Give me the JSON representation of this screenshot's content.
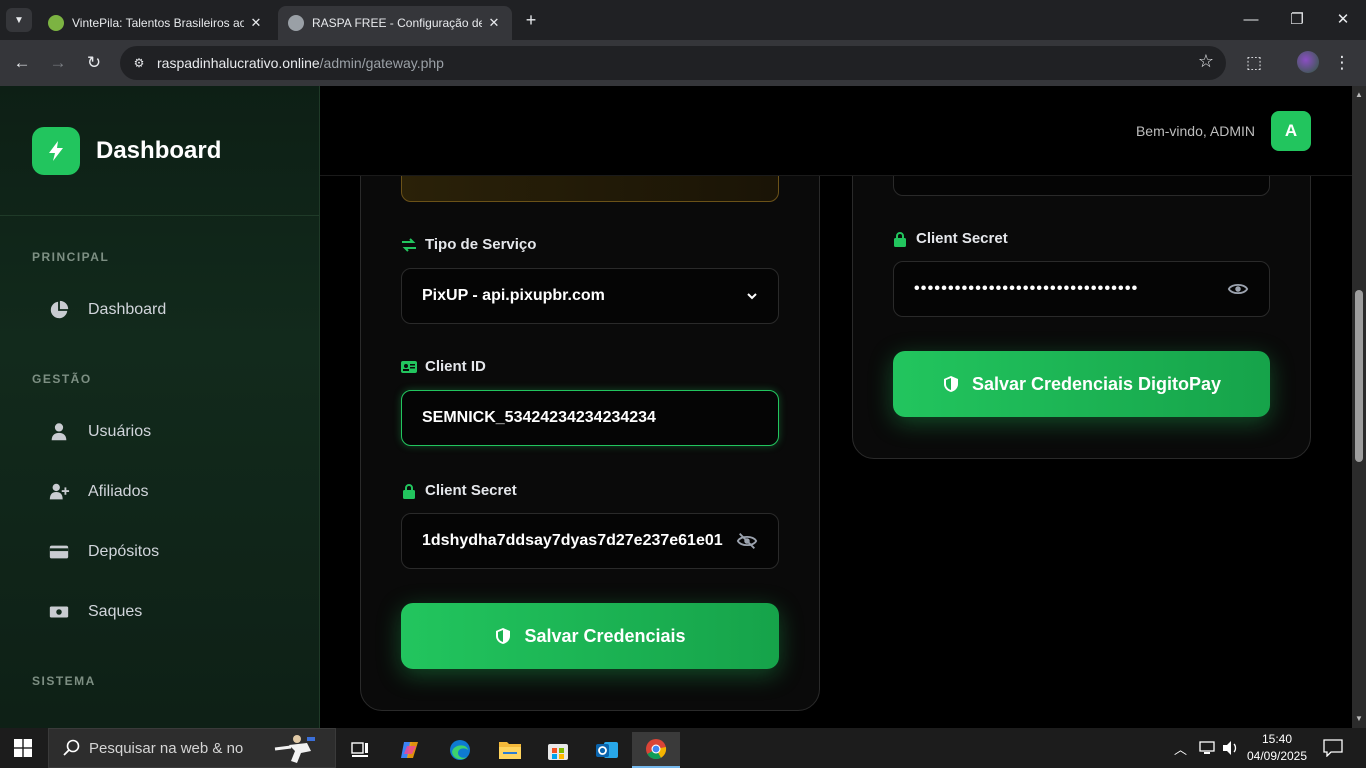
{
  "browser": {
    "tabs": [
      {
        "title": "VintePila: Talentos Brasileiros ao",
        "favicon_color": "#7cb342"
      },
      {
        "title": "RASPA FREE - Configuração de G",
        "favicon_color": "#9aa0a6"
      }
    ],
    "url_domain": "raspadinhalucrativo.online",
    "url_path": "/admin/gateway.php"
  },
  "sidebar": {
    "brand": "Dashboard",
    "sections": [
      {
        "title": "PRINCIPAL",
        "items": [
          {
            "label": "Dashboard",
            "icon": "chart-pie-icon"
          }
        ]
      },
      {
        "title": "GESTÃO",
        "items": [
          {
            "label": "Usuários",
            "icon": "user-icon"
          },
          {
            "label": "Afiliados",
            "icon": "user-plus-icon"
          },
          {
            "label": "Depósitos",
            "icon": "credit-card-icon"
          },
          {
            "label": "Saques",
            "icon": "money-bill-icon"
          }
        ]
      },
      {
        "title": "SISTEMA",
        "items": []
      }
    ]
  },
  "header": {
    "welcome": "Bem-vindo, ADMIN",
    "avatar_letter": "A"
  },
  "left_card": {
    "service_label": "Tipo de Serviço",
    "service_value": "PixUP - api.pixupbr.com",
    "client_id_label": "Client ID",
    "client_id_value": "SEMNICK_53424234234234234",
    "client_secret_label": "Client Secret",
    "client_secret_value": "1dshydha7ddsay7dyas7d27e237e61e01",
    "save_button": "Salvar Credenciais"
  },
  "right_card": {
    "client_secret_label": "Client Secret",
    "client_secret_masked": "•••••••••••••••••••••••••••••••••",
    "save_button": "Salvar Credenciais DigitoPay"
  },
  "taskbar": {
    "search_placeholder": "Pesquisar na web & no",
    "time": "15:40",
    "date": "04/09/2025"
  },
  "colors": {
    "accent": "#22c55e",
    "accent_dark": "#16a34a"
  }
}
